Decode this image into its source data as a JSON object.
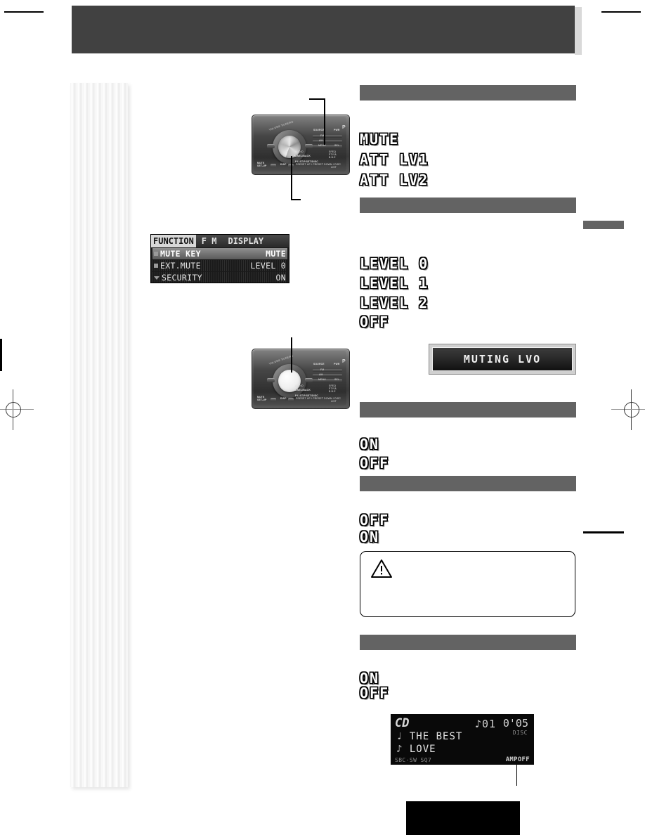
{
  "page": {
    "background_color": "#ffffff",
    "redaction_color": "#636363",
    "header_color": "#414141"
  },
  "header": {
    "band_label": "redacted-header-band"
  },
  "left_column": {
    "stripe_label": "vertical-striped-panel"
  },
  "function_menu_display": {
    "screen_label": "FUNCTION menu LCD",
    "tabs": {
      "selected": "FUNCTION",
      "others": [
        "F M",
        "DISPLAY"
      ]
    },
    "rows": [
      {
        "marker": "bullet",
        "label": "MUTE KEY",
        "separator": "-",
        "value": "MUTE",
        "highlighted": true
      },
      {
        "marker": "bullet",
        "label": "EXT.MUTE",
        "separator": "-",
        "value": "LEVEL 0",
        "highlighted": false
      },
      {
        "marker": "arrow",
        "label": "SECURITY",
        "separator": "-",
        "value": "ON",
        "highlighted": false
      }
    ]
  },
  "muting_display": {
    "text": "MUTING LVO"
  },
  "cd_display": {
    "source": "CD",
    "track_icon": "eighth-note",
    "track_number": "01",
    "elapsed_time": "0'05",
    "disc_label": "DISC",
    "line1_icon": "note-small",
    "line1": "THE BEST",
    "line2_icon": "eighth-note",
    "line2": "LOVE",
    "footer_indicators": "SBC·SW  SQ7",
    "amp_indicator": "AMPOFF"
  },
  "sections": [
    {
      "id": "section-mute-key",
      "heading_redacted": true,
      "options": [
        "MUTE",
        "ATT LV1",
        "ATT LV2"
      ]
    },
    {
      "id": "section-ext-mute",
      "heading_redacted": true,
      "options": [
        "LEVEL 0",
        "LEVEL 1",
        "LEVEL 2",
        "OFF"
      ]
    },
    {
      "id": "section-security",
      "heading_redacted": true,
      "options": [
        "ON",
        "OFF"
      ]
    },
    {
      "id": "section-amp-off",
      "heading_redacted": true,
      "options": [
        "OFF",
        "ON"
      ],
      "has_caution_box": true
    },
    {
      "id": "section-last",
      "heading_redacted": true,
      "options": [
        "ON",
        "OFF"
      ]
    }
  ],
  "caution_box": {
    "icon": "warning-triangle",
    "body_redacted": true
  },
  "units": [
    {
      "id": "head-unit-top",
      "brand_mark": "P",
      "controls": [
        "SOURCE",
        "PWR",
        "FM",
        "AM",
        "MENU",
        "SEL",
        "BAND",
        "SFEQ",
        "AUDIO",
        "P.MODE",
        "PTY",
        "DISP",
        "MUTE",
        "SET-UP",
        "DISP",
        "EJECT",
        "CLEAR",
        "PANEL/BACK"
      ],
      "callout_count": 2
    },
    {
      "id": "head-unit-bottom",
      "brand_mark": "P",
      "controls": [
        "SOURCE",
        "PWR",
        "FM",
        "AM",
        "MENU",
        "SEL",
        "BAND",
        "SFEQ",
        "AUDIO",
        "P.MODE",
        "PTY",
        "DISP",
        "MUTE",
        "SET-UP",
        "DISP",
        "EJECT",
        "CLEAR",
        "PANEL/BACK"
      ],
      "callout_count": 1
    }
  ],
  "marks": {
    "registration": "crosshair-circle",
    "crop": "crop-line",
    "tab_marker": "side-tab"
  }
}
